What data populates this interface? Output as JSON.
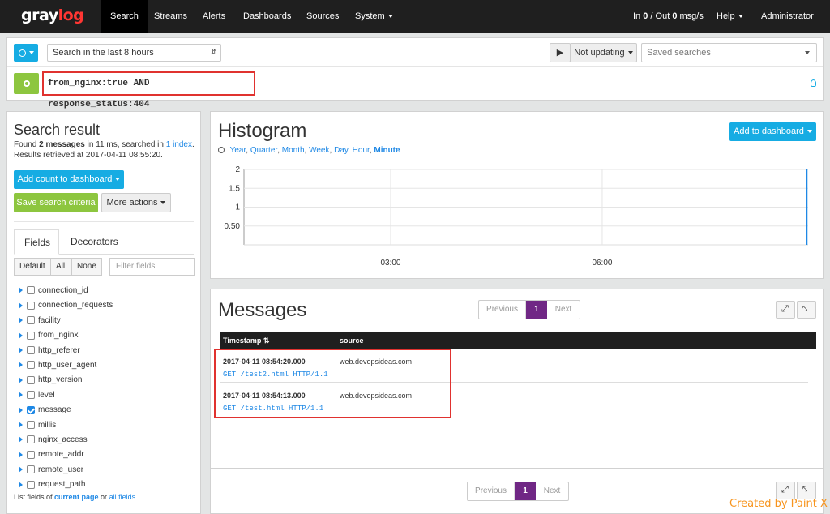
{
  "nav": {
    "logo_a": "gray",
    "logo_b": "log",
    "items": [
      "Search",
      "Streams",
      "Alerts",
      "Dashboards",
      "Sources",
      "System"
    ],
    "throughput_pre": "In ",
    "throughput_in": "0",
    "throughput_mid": " / Out ",
    "throughput_out": "0",
    "throughput_post": " msg/s",
    "help": "Help",
    "user": "Administrator"
  },
  "search": {
    "timerange": "Search in the last 8 hours",
    "query": "from_nginx:true AND response_status:404",
    "update": "Not updating",
    "saved_placeholder": "Saved searches"
  },
  "result": {
    "title": "Search result",
    "line1_pre": "Found ",
    "line1_count": "2 messages",
    "line1_mid": " in 11 ms, searched in ",
    "line1_link": "1 index",
    "line1_post": ".",
    "line2": "Results retrieved at 2017-04-11 08:55:20.",
    "add_count": "Add count to dashboard",
    "save": "Save search criteria",
    "more": "More actions"
  },
  "fields_tabs": [
    "Fields",
    "Decorators"
  ],
  "filter": {
    "default": "Default",
    "all": "All",
    "none": "None",
    "placeholder": "Filter fields"
  },
  "fields": [
    {
      "name": "connection_id",
      "checked": false
    },
    {
      "name": "connection_requests",
      "checked": false
    },
    {
      "name": "facility",
      "checked": false
    },
    {
      "name": "from_nginx",
      "checked": false
    },
    {
      "name": "http_referer",
      "checked": false
    },
    {
      "name": "http_user_agent",
      "checked": false
    },
    {
      "name": "http_version",
      "checked": false
    },
    {
      "name": "level",
      "checked": false
    },
    {
      "name": "message",
      "checked": true
    },
    {
      "name": "millis",
      "checked": false
    },
    {
      "name": "nginx_access",
      "checked": false
    },
    {
      "name": "remote_addr",
      "checked": false
    },
    {
      "name": "remote_user",
      "checked": false
    },
    {
      "name": "request_path",
      "checked": false
    }
  ],
  "fields_footer": {
    "pre": "List fields of ",
    "link1": "current page",
    "mid": " or ",
    "link2": "all fields",
    "post": "."
  },
  "histogram": {
    "title": "Histogram",
    "add_button": "Add to dashboard",
    "resolutions": [
      "Year",
      "Quarter",
      "Month",
      "Week",
      "Day",
      "Hour",
      "Minute"
    ],
    "active_resolution": "Minute"
  },
  "chart_data": {
    "type": "bar",
    "title": "",
    "xlabel": "",
    "ylabel": "",
    "ytick_labels": [
      "2",
      "1.5",
      "1",
      "0.50"
    ],
    "yticks": [
      2,
      1.5,
      1,
      0.5
    ],
    "ylim": [
      0,
      2
    ],
    "xtick_labels": [
      "03:00",
      "06:00"
    ],
    "xticks": [
      3,
      6
    ],
    "xlim": [
      0.92,
      8.92
    ],
    "x": [
      8.9
    ],
    "values": [
      2
    ],
    "grid": true
  },
  "messages": {
    "title": "Messages",
    "prev": "Previous",
    "page": "1",
    "next": "Next",
    "col_timestamp": "Timestamp",
    "col_source": "source",
    "rows": [
      {
        "timestamp": "2017-04-11 08:54:20.000",
        "source": "web.devopsideas.com",
        "message": "GET /test2.html HTTP/1.1"
      },
      {
        "timestamp": "2017-04-11 08:54:13.000",
        "source": "web.devopsideas.com",
        "message": "GET /test.html HTTP/1.1"
      }
    ]
  },
  "watermark": "Created by Paint X"
}
